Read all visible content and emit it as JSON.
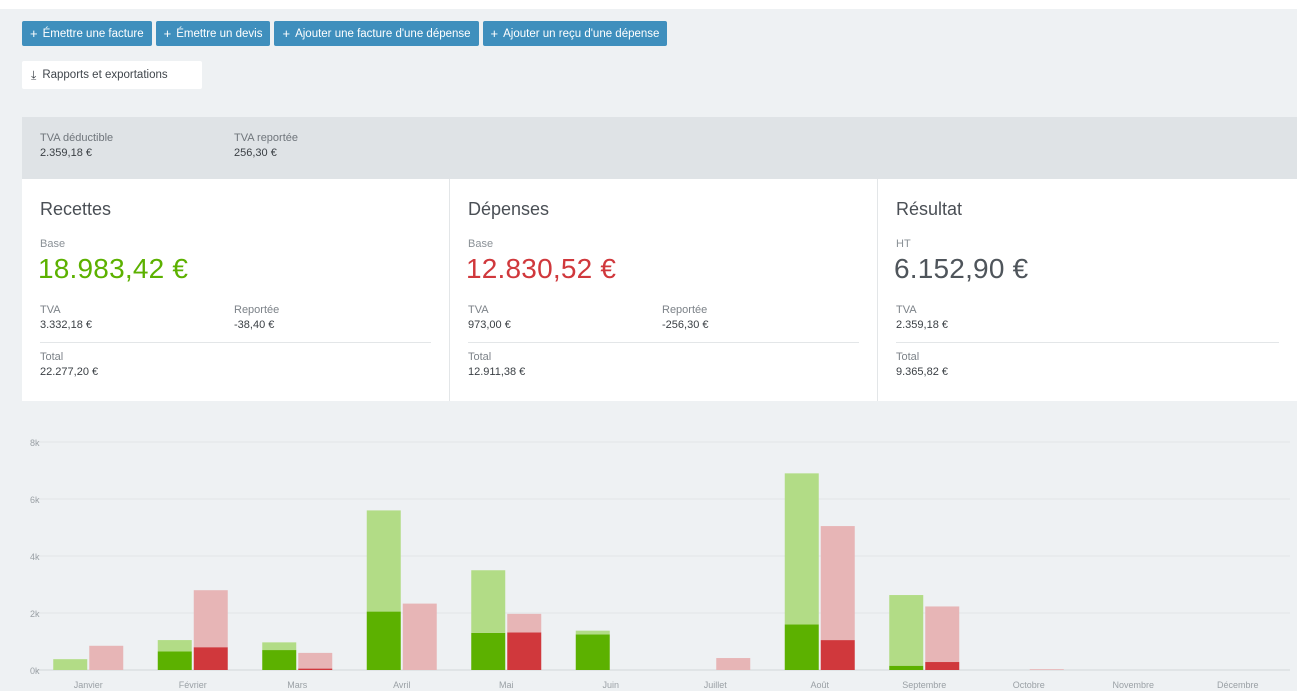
{
  "actions": [
    {
      "icon": "plus-icon",
      "label": "Émettre une facture"
    },
    {
      "icon": "plus-icon",
      "label": "Émettre un devis"
    },
    {
      "icon": "plus-icon",
      "label": "Ajouter une facture d'une dépense"
    },
    {
      "icon": "plus-icon",
      "label": "Ajouter un reçu d'une dépense"
    }
  ],
  "export": {
    "icon": "download-icon",
    "label": "Rapports et exportations"
  },
  "vat_summary": {
    "deductible": {
      "label": "TVA déductible",
      "value": "2.359,18 €"
    },
    "carried": {
      "label": "TVA reportée",
      "value": "256,30 €"
    }
  },
  "cards": {
    "recettes": {
      "title": "Recettes",
      "base_label": "Base",
      "base_value": "18.983,42 €",
      "tva_label": "TVA",
      "tva_value": "3.332,18 €",
      "reported_label": "Reportée",
      "reported_value": "-38,40 €",
      "total_label": "Total",
      "total_value": "22.277,20 €"
    },
    "depenses": {
      "title": "Dépenses",
      "base_label": "Base",
      "base_value": "12.830,52 €",
      "tva_label": "TVA",
      "tva_value": "973,00 €",
      "reported_label": "Reportée",
      "reported_value": "-256,30 €",
      "total_label": "Total",
      "total_value": "12.911,38 €"
    },
    "resultat": {
      "title": "Résultat",
      "base_label": "HT",
      "base_value": "6.152,90 €",
      "tva_label": "TVA",
      "tva_value": "2.359,18 €",
      "total_label": "Total",
      "total_value": "9.365,82 €"
    }
  },
  "colors": {
    "income": "#5cb100",
    "income_light": "#b2dc86",
    "expense": "#d0383c",
    "expense_light": "#e7b5b6",
    "button": "#3f8fbd"
  },
  "chart_data": {
    "type": "bar",
    "categories": [
      "Janvier",
      "Février",
      "Mars",
      "Avril",
      "Mai",
      "Juin",
      "Juillet",
      "Août",
      "Septembre",
      "Octobre",
      "Novembre",
      "Décembre"
    ],
    "ylim": [
      0,
      8000
    ],
    "yticks": [
      0,
      2000,
      4000,
      6000,
      8000
    ],
    "ytick_labels": [
      "0k",
      "2k",
      "4k",
      "6k",
      "8k"
    ],
    "grid": true,
    "stacked_groups": [
      {
        "group": "recettes",
        "series": [
          {
            "values": [
              0,
              650,
              700,
              2050,
              1300,
              1250,
              0,
              1600,
              150,
              0,
              0,
              0
            ],
            "color": "#5cb100"
          },
          {
            "values": [
              380,
              400,
              270,
              3550,
              2200,
              130,
              0,
              5300,
              2480,
              0,
              0,
              0
            ],
            "color": "#b2dc86"
          }
        ]
      },
      {
        "group": "depenses",
        "series": [
          {
            "values": [
              0,
              800,
              50,
              0,
              1320,
              0,
              0,
              1050,
              280,
              0,
              0,
              0
            ],
            "color": "#d0383c"
          },
          {
            "values": [
              850,
              2000,
              550,
              2330,
              650,
              0,
              420,
              4000,
              1950,
              30,
              0,
              0
            ],
            "color": "#e7b5b6"
          }
        ]
      }
    ]
  }
}
